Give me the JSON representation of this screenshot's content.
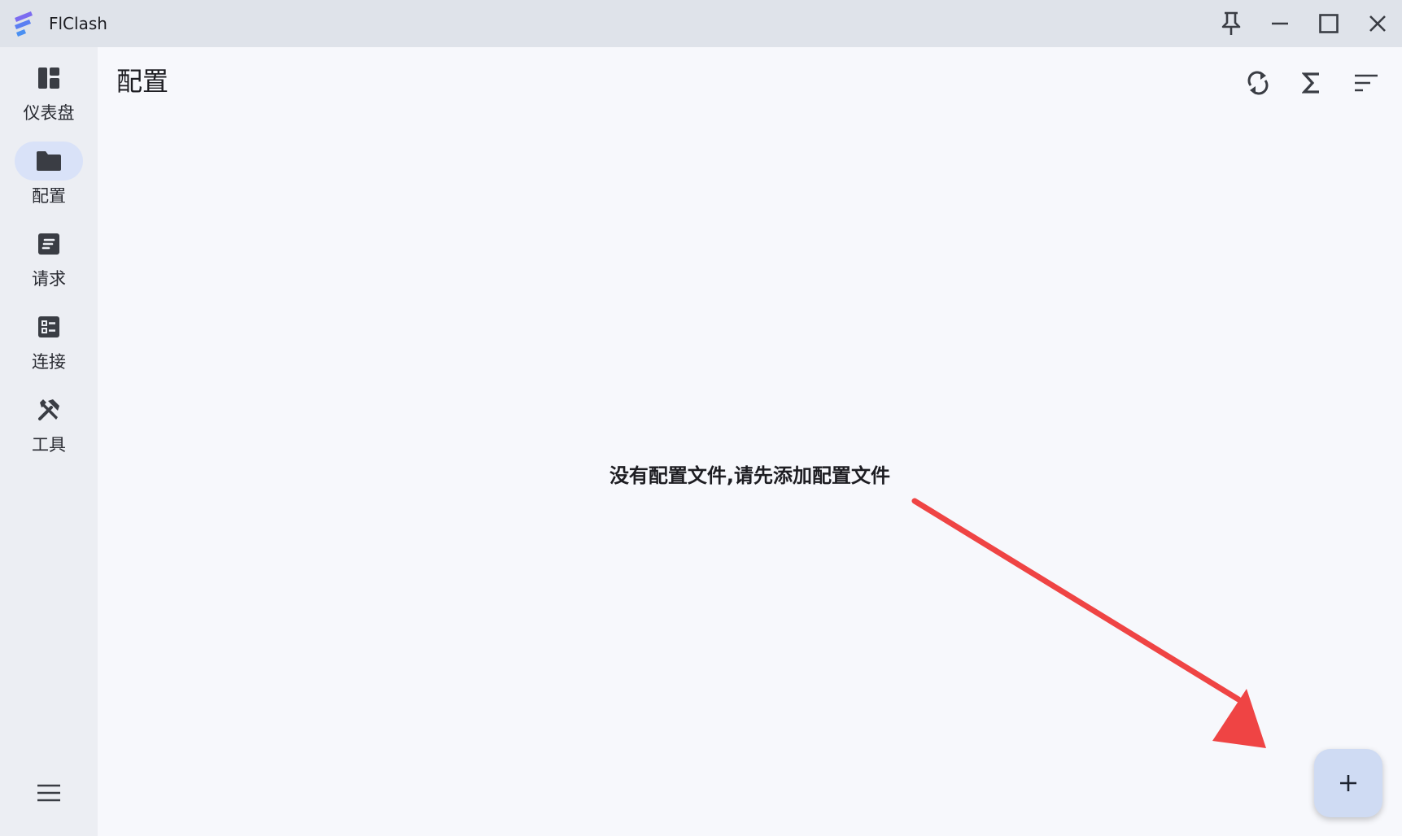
{
  "window": {
    "title": "FlClash",
    "controls": [
      "pin-icon",
      "minimize-icon",
      "maximize-icon",
      "close-icon"
    ]
  },
  "sidebar": {
    "items": [
      {
        "label": "仪表盘",
        "icon": "dashboard-icon",
        "active": false
      },
      {
        "label": "配置",
        "icon": "folder-icon",
        "active": true
      },
      {
        "label": "请求",
        "icon": "requests-icon",
        "active": false
      },
      {
        "label": "连接",
        "icon": "connections-icon",
        "active": false
      },
      {
        "label": "工具",
        "icon": "tools-icon",
        "active": false
      }
    ],
    "menu_icon": "menu-icon"
  },
  "main": {
    "title": "配置",
    "actions": [
      "sync-icon",
      "sigma-icon",
      "sort-icon"
    ],
    "empty_message": "没有配置文件,请先添加配置文件",
    "fab_icon": "plus-icon"
  },
  "colors": {
    "titlebar": "#dfe3ea",
    "sidebar": "#eceef3",
    "background": "#f7f8fc",
    "active_nav": "#d9e2f8",
    "fab": "#cfdbf3",
    "annotation_arrow": "#ef4444",
    "icon": "#3a3d44"
  }
}
